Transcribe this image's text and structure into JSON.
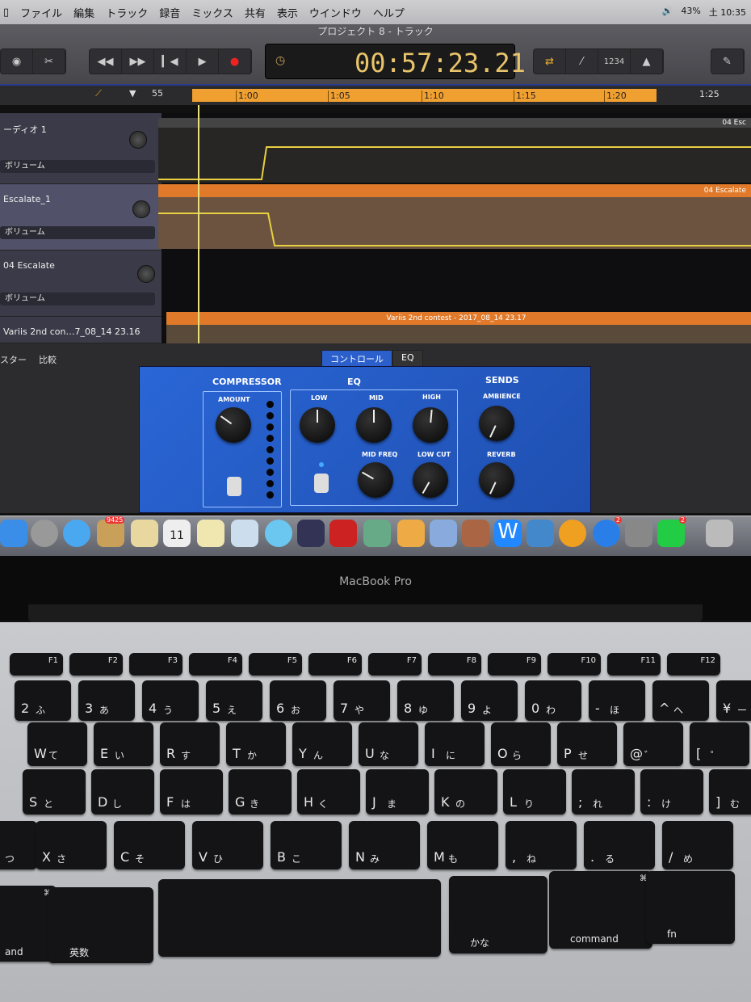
{
  "menubar": {
    "items": [
      "ファイル",
      "編集",
      "トラック",
      "録音",
      "ミックス",
      "共有",
      "表示",
      "ウインドウ",
      "ヘルプ"
    ],
    "battery": "43%",
    "clock": "土 10:35"
  },
  "window": {
    "title": "プロジェクト 8 - トラック"
  },
  "transport": {
    "buttons": [
      "rewind",
      "fast-forward",
      "go-to-start",
      "play",
      "record"
    ],
    "time": "00:57:23.21",
    "count_in": "1234"
  },
  "ruler": {
    "start": "55",
    "ticks": [
      "1:00",
      "1:05",
      "1:10",
      "1:15",
      "1:20"
    ],
    "end": "1:25"
  },
  "tracks": [
    {
      "name": "ーディオ 1",
      "automation": "ボリューム",
      "region": "04 Esc"
    },
    {
      "name": "Escalate_1",
      "automation": "ボリューム",
      "region": "04 Escalate"
    },
    {
      "name": "04 Escalate",
      "automation": "ボリューム",
      "region": ""
    },
    {
      "name": "Variis 2nd con…7_08_14 23.16",
      "automation": "",
      "region": "Variis 2nd contest - 2017_08_14 23.17"
    }
  ],
  "editor": {
    "left_buttons": [
      "スター",
      "比較"
    ],
    "tabs": [
      "コントロール",
      "EQ"
    ],
    "active_tab": "コントロール"
  },
  "plugin": {
    "compressor": {
      "title": "COMPRESSOR",
      "amount": "AMOUNT"
    },
    "eq": {
      "title": "EQ",
      "low": "LOW",
      "mid": "MID",
      "high": "HIGH",
      "mid_freq": "MID FREQ",
      "low_cut": "LOW CUT"
    },
    "sends": {
      "title": "SENDS",
      "ambience": "AMBIENCE",
      "reverb": "REVERB"
    }
  },
  "dock": {
    "calendar_day": "11",
    "badges": [
      "9425",
      "2",
      "2"
    ]
  },
  "laptop": {
    "brand": "MacBook Pro"
  },
  "keyboard": {
    "fn_row": [
      "F1",
      "F2",
      "F3",
      "F4",
      "F5",
      "F6",
      "F7",
      "F8",
      "F9",
      "F10",
      "F11",
      "F12"
    ],
    "row1": [
      [
        "2",
        "ふ"
      ],
      [
        "3",
        "あ"
      ],
      [
        "4",
        "う"
      ],
      [
        "5",
        "え"
      ],
      [
        "6",
        "お"
      ],
      [
        "7",
        "や"
      ],
      [
        "8",
        "ゆ"
      ],
      [
        "9",
        "よ"
      ],
      [
        "0",
        "わ"
      ],
      [
        "-",
        "ほ"
      ],
      [
        "^",
        "へ"
      ],
      [
        "¥",
        "ー"
      ]
    ],
    "row2": [
      [
        "W",
        "て"
      ],
      [
        "E",
        "い"
      ],
      [
        "R",
        "す"
      ],
      [
        "T",
        "か"
      ],
      [
        "Y",
        "ん"
      ],
      [
        "U",
        "な"
      ],
      [
        "I",
        "に"
      ],
      [
        "O",
        "ら"
      ],
      [
        "P",
        "せ"
      ],
      [
        "@",
        "゛"
      ],
      [
        "[",
        "゜"
      ]
    ],
    "row3": [
      [
        "S",
        "と"
      ],
      [
        "D",
        "し"
      ],
      [
        "F",
        "は"
      ],
      [
        "G",
        "き"
      ],
      [
        "H",
        "く"
      ],
      [
        "J",
        "ま"
      ],
      [
        "K",
        "の"
      ],
      [
        "L",
        "り"
      ],
      [
        ";",
        "れ"
      ],
      [
        ":",
        "け"
      ],
      [
        "]",
        "む"
      ]
    ],
    "row4": [
      [
        "",
        "つ"
      ],
      [
        "X",
        "さ"
      ],
      [
        "C",
        "そ"
      ],
      [
        "V",
        "ひ"
      ],
      [
        "B",
        "こ"
      ],
      [
        "N",
        "み"
      ],
      [
        "M",
        "も"
      ],
      [
        ",",
        "ね"
      ],
      [
        ".",
        "る"
      ],
      [
        "/",
        "め"
      ]
    ],
    "bottom": {
      "command_left": "and",
      "eisu": "英数",
      "kana": "かな",
      "command": "command",
      "fn": "fn"
    }
  }
}
